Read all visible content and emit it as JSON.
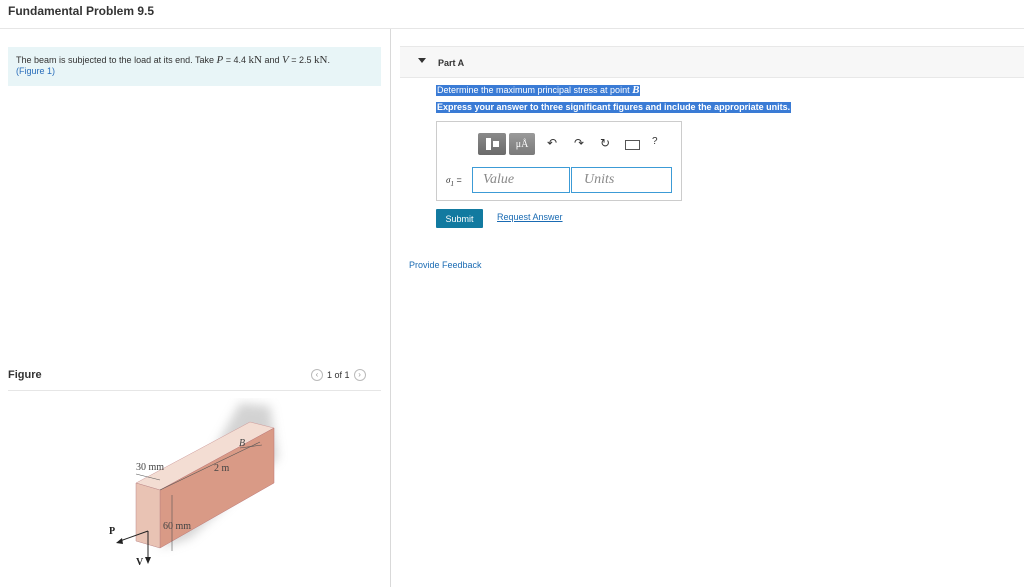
{
  "page": {
    "title": "Fundamental Problem 9.5"
  },
  "intro": {
    "text1": "The beam is subjected to the load at its end. Take ",
    "p_var": "P",
    "eq1": " = 4.4 ",
    "unit1": "kN",
    "and": " and ",
    "v_var": "V",
    "eq2": " = 2.5 ",
    "unit2": "kN",
    "period": ".",
    "figure_link": "(Figure 1)"
  },
  "figure": {
    "label": "Figure",
    "pager": "1 of 1",
    "prev_icon": "chevron-left-icon",
    "next_icon": "chevron-right-icon",
    "dim_30mm": "30 mm",
    "dim_60mm": "60 mm",
    "dim_2m": "2 m",
    "point_b": "B",
    "load_p": "P",
    "load_v": "V",
    "colors": {
      "front": "#e9c3b4",
      "top": "#f3ddd3",
      "side": "#d99a86",
      "shadow": "#c8c8c8"
    }
  },
  "part_a": {
    "heading": "Part A",
    "question_prefix": "Determine the maximum principal stress at point ",
    "question_point": "B",
    "instruction": "Express your answer to three significant figures and include the appropriate units.",
    "toolbar": {
      "templates_icon": "templates-icon",
      "units_btn": "μÅ",
      "undo_icon": "undo-icon",
      "redo_icon": "redo-icon",
      "reset_icon": "reset-icon",
      "keyboard_icon": "keyboard-icon",
      "help": "?"
    },
    "var_symbol": "σ",
    "var_sub": "1",
    "equals": " =",
    "value_placeholder": "Value",
    "units_placeholder": "Units",
    "submit_label": "Submit",
    "request_label": "Request Answer"
  },
  "feedback": {
    "label": "Provide Feedback"
  },
  "colors": {
    "accent": "#127aa0",
    "link": "#1a6bb3",
    "highlight": "#3a7bd5",
    "input_border": "#3c9bd6",
    "intro_bg": "#e8f5f7"
  }
}
